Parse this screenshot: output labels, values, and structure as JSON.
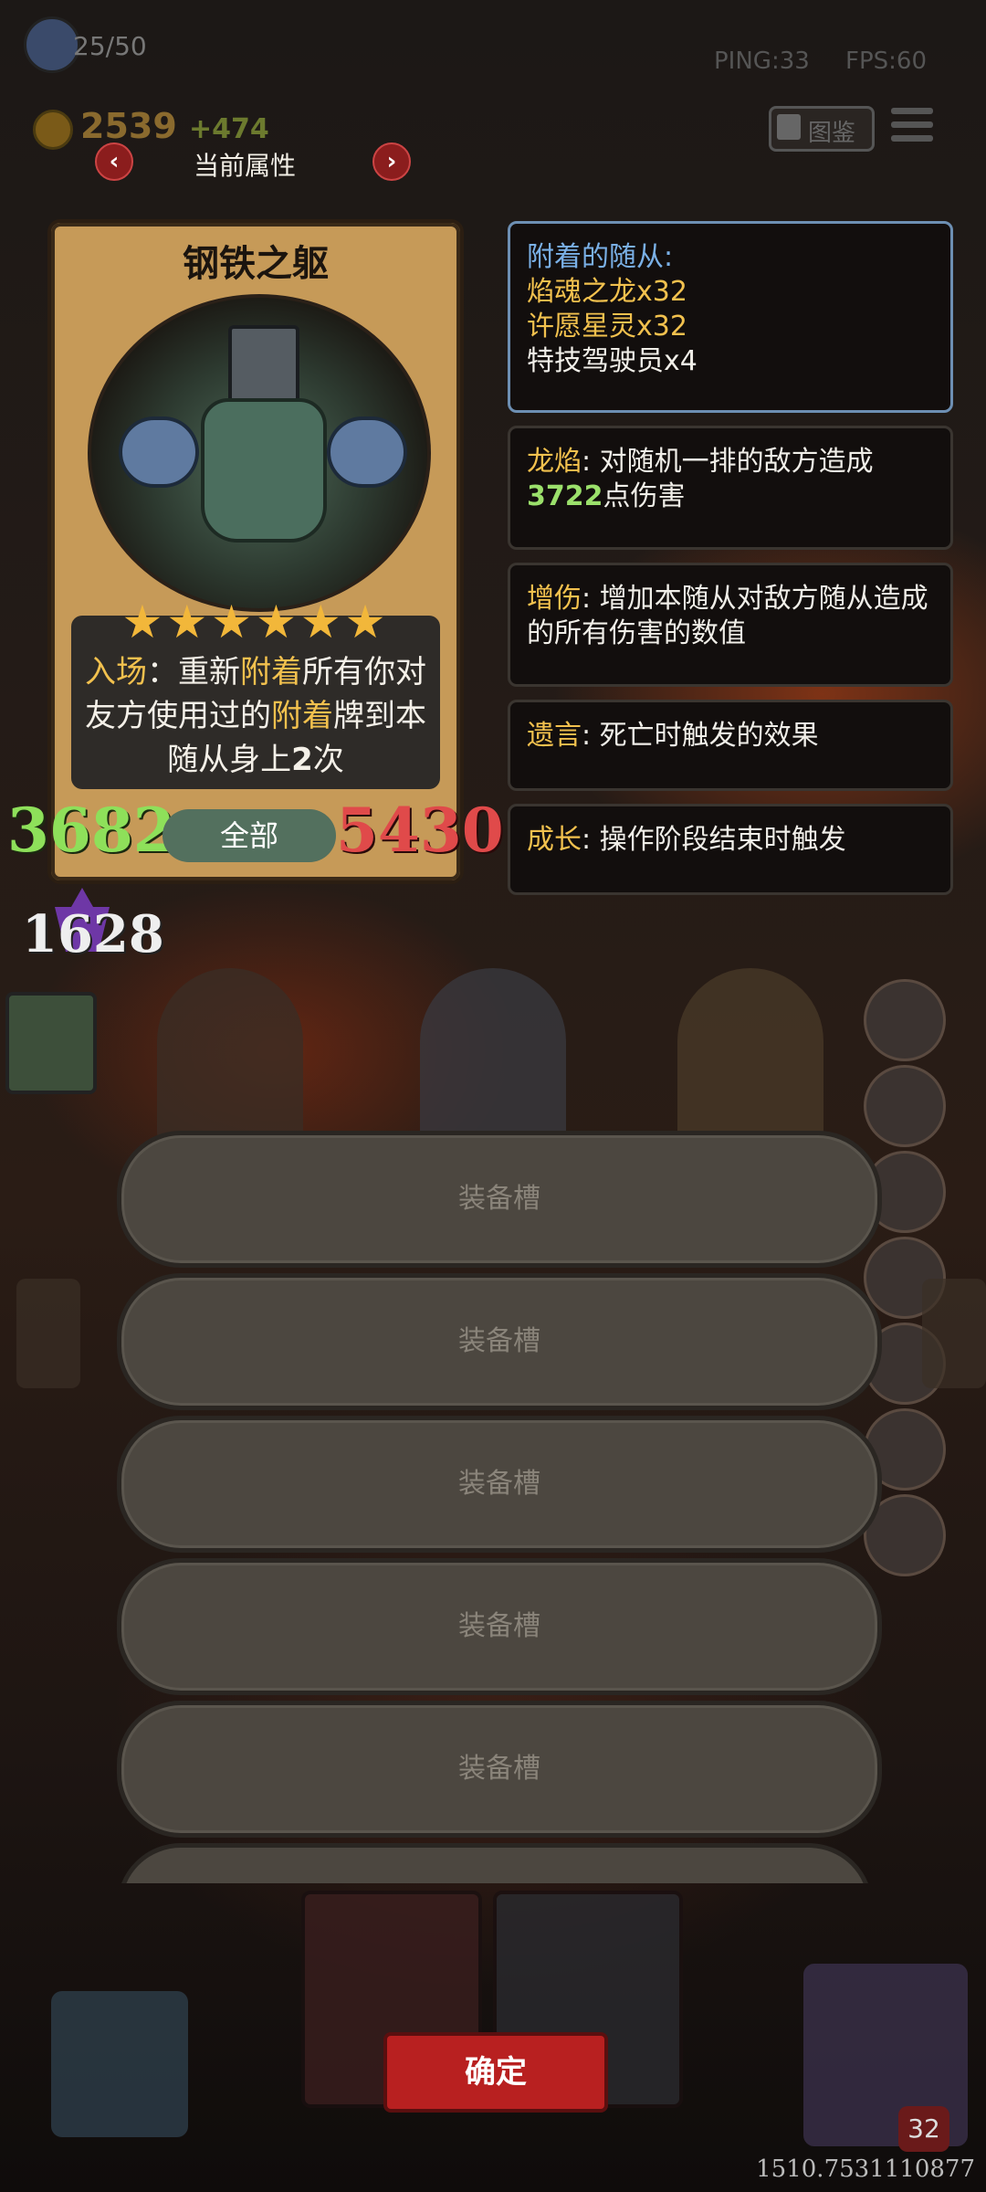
{
  "hud": {
    "population": "25/50",
    "ping": "PING:33",
    "fps": "FPS:60",
    "coins": "2539",
    "coins_gain": "+474",
    "codex_label": "图鉴"
  },
  "attr_header": {
    "title": "当前属性",
    "prev_icon": "‹",
    "next_icon": "›"
  },
  "card": {
    "name": "钢铁之躯",
    "stars": "★★★★★★",
    "star_count": 6,
    "desc_parts": [
      "入场",
      "：重新",
      "附着",
      "所有你对友方使用过的",
      "附着",
      "牌到本随从身上",
      "2",
      "次"
    ],
    "attack": "3682",
    "health": "5430",
    "filter_label": "全部",
    "shield": "1628"
  },
  "info_panels": {
    "attached": {
      "title": "附着的随从:",
      "items": [
        "焰魂之龙x32",
        "许愿星灵x32",
        "特技驾驶员x4"
      ]
    },
    "dragon_flame": {
      "label": "龙焰",
      "text1": ": 对随机一排的敌方造成",
      "value": "3722",
      "text2": "点伤害"
    },
    "boost": {
      "label": "增伤",
      "text": ": 增加本随从对敌方随从造成的所有伤害的数值"
    },
    "deathrattle": {
      "label": "遗言",
      "text": ": 死亡时触发的效果"
    },
    "growth": {
      "label": "成长",
      "text": ": 操作阶段结束时触发"
    }
  },
  "slots": [
    "装备槽",
    "装备槽",
    "装备槽",
    "装备槽",
    "装备槽"
  ],
  "confirm_label": "确定",
  "bottom_counter": "32",
  "bottom_number": "1510.7531110877",
  "colors": {
    "attack": "#8ee05a",
    "health": "#e04a4a",
    "keyword": "#f2c14e",
    "confirm": "#b82020"
  }
}
